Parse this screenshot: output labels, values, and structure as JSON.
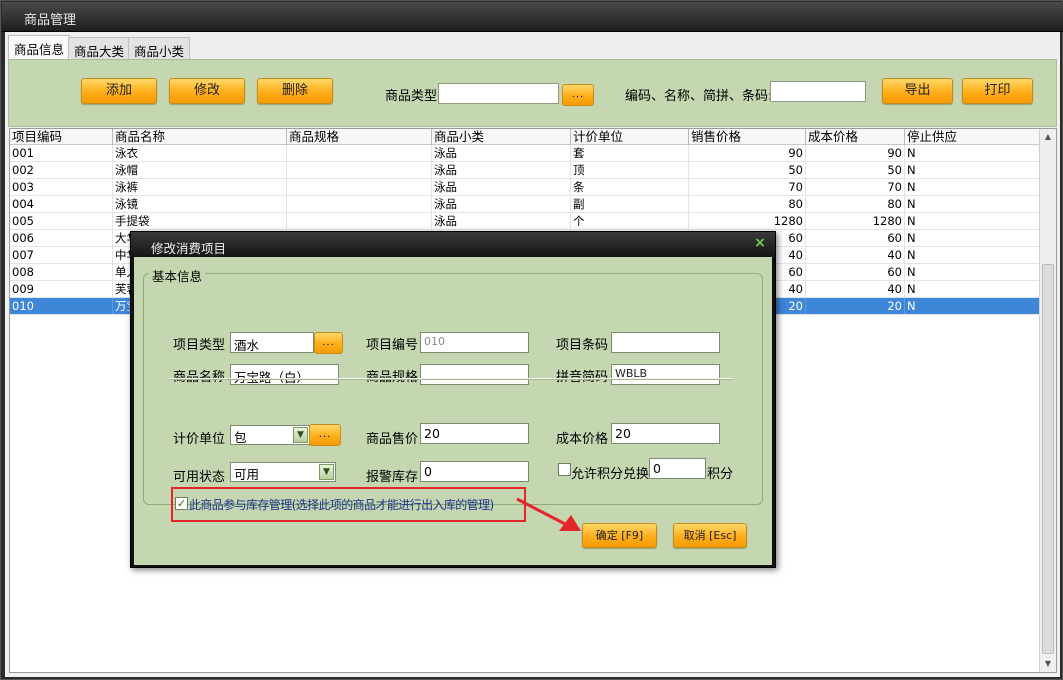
{
  "window": {
    "title": "商品管理"
  },
  "tabs": [
    {
      "label": "商品信息",
      "active": true
    },
    {
      "label": "商品大类",
      "active": false
    },
    {
      "label": "商品小类",
      "active": false
    }
  ],
  "toolbar": {
    "add_label": "添加",
    "edit_label": "修改",
    "delete_label": "删除",
    "type_label": "商品类型",
    "type_value": "",
    "type_picker_label": "...",
    "search_label": "编码、名称、简拼、条码:",
    "search_value": "",
    "export_label": "导出",
    "print_label": "打印"
  },
  "grid": {
    "columns": [
      "项目编码",
      "商品名称",
      "商品规格",
      "商品小类",
      "计价单位",
      "销售价格",
      "成本价格",
      "停止供应"
    ],
    "rows": [
      {
        "code": "001",
        "name": "泳衣",
        "spec": "",
        "category": "泳品",
        "unit": "套",
        "sale": "90",
        "cost": "90",
        "stop": "N"
      },
      {
        "code": "002",
        "name": "泳帽",
        "spec": "",
        "category": "泳品",
        "unit": "顶",
        "sale": "50",
        "cost": "50",
        "stop": "N"
      },
      {
        "code": "003",
        "name": "泳裤",
        "spec": "",
        "category": "泳品",
        "unit": "条",
        "sale": "70",
        "cost": "70",
        "stop": "N"
      },
      {
        "code": "004",
        "name": "泳镜",
        "spec": "",
        "category": "泳品",
        "unit": "副",
        "sale": "80",
        "cost": "80",
        "stop": "N"
      },
      {
        "code": "005",
        "name": "手提袋",
        "spec": "",
        "category": "泳品",
        "unit": "个",
        "sale": "1280",
        "cost": "1280",
        "stop": "N"
      },
      {
        "code": "006",
        "name": "大华",
        "spec": "",
        "category": "",
        "unit": "",
        "sale": "60",
        "cost": "60",
        "stop": "N"
      },
      {
        "code": "007",
        "name": "中华",
        "spec": "",
        "category": "",
        "unit": "",
        "sale": "40",
        "cost": "40",
        "stop": "N"
      },
      {
        "code": "008",
        "name": "单人",
        "spec": "",
        "category": "",
        "unit": "",
        "sale": "60",
        "cost": "60",
        "stop": "N"
      },
      {
        "code": "009",
        "name": "芙蓉",
        "spec": "",
        "category": "",
        "unit": "",
        "sale": "40",
        "cost": "40",
        "stop": "N"
      },
      {
        "code": "010",
        "name": "万宝",
        "spec": "",
        "category": "",
        "unit": "",
        "sale": "20",
        "cost": "20",
        "stop": "N",
        "selected": true
      }
    ]
  },
  "dialog": {
    "title": "修改消费项目",
    "close_label": "×",
    "group_label": "基本信息",
    "fields": {
      "item_type_label": "项目类型",
      "item_type_value": "酒水",
      "item_code_label": "项目编号",
      "item_code_value": "010",
      "item_barcode_label": "项目条码",
      "item_barcode_value": "",
      "product_name_label": "商品名称",
      "product_name_value": "万宝路（白）",
      "product_spec_label": "商品规格",
      "product_spec_value": "",
      "pinyin_label": "拼音简码",
      "pinyin_value": "WBLB",
      "unit_label": "计价单位",
      "unit_value": "包",
      "sale_price_label": "商品售价",
      "sale_price_value": "20",
      "cost_price_label": "成本价格",
      "cost_price_value": "20",
      "status_label": "可用状态",
      "status_value": "可用",
      "alert_stock_label": "报警库存",
      "alert_stock_value": "0",
      "allow_points_label": "允许积分兑换",
      "allow_points_checked": false,
      "points_value": "0",
      "points_suffix": "积分",
      "inventory_label": "此商品参与库存管理(选择此项的商品才能进行出入库的管理)",
      "inventory_checked": true
    },
    "ok_label": "确定 [F9]",
    "cancel_label": "取消 [Esc]"
  },
  "colors": {
    "panel_green": "#c4d7b0",
    "button_orange": "#ffae19",
    "selection_blue": "#3d86d8",
    "annotation_red": "#e4262b"
  }
}
